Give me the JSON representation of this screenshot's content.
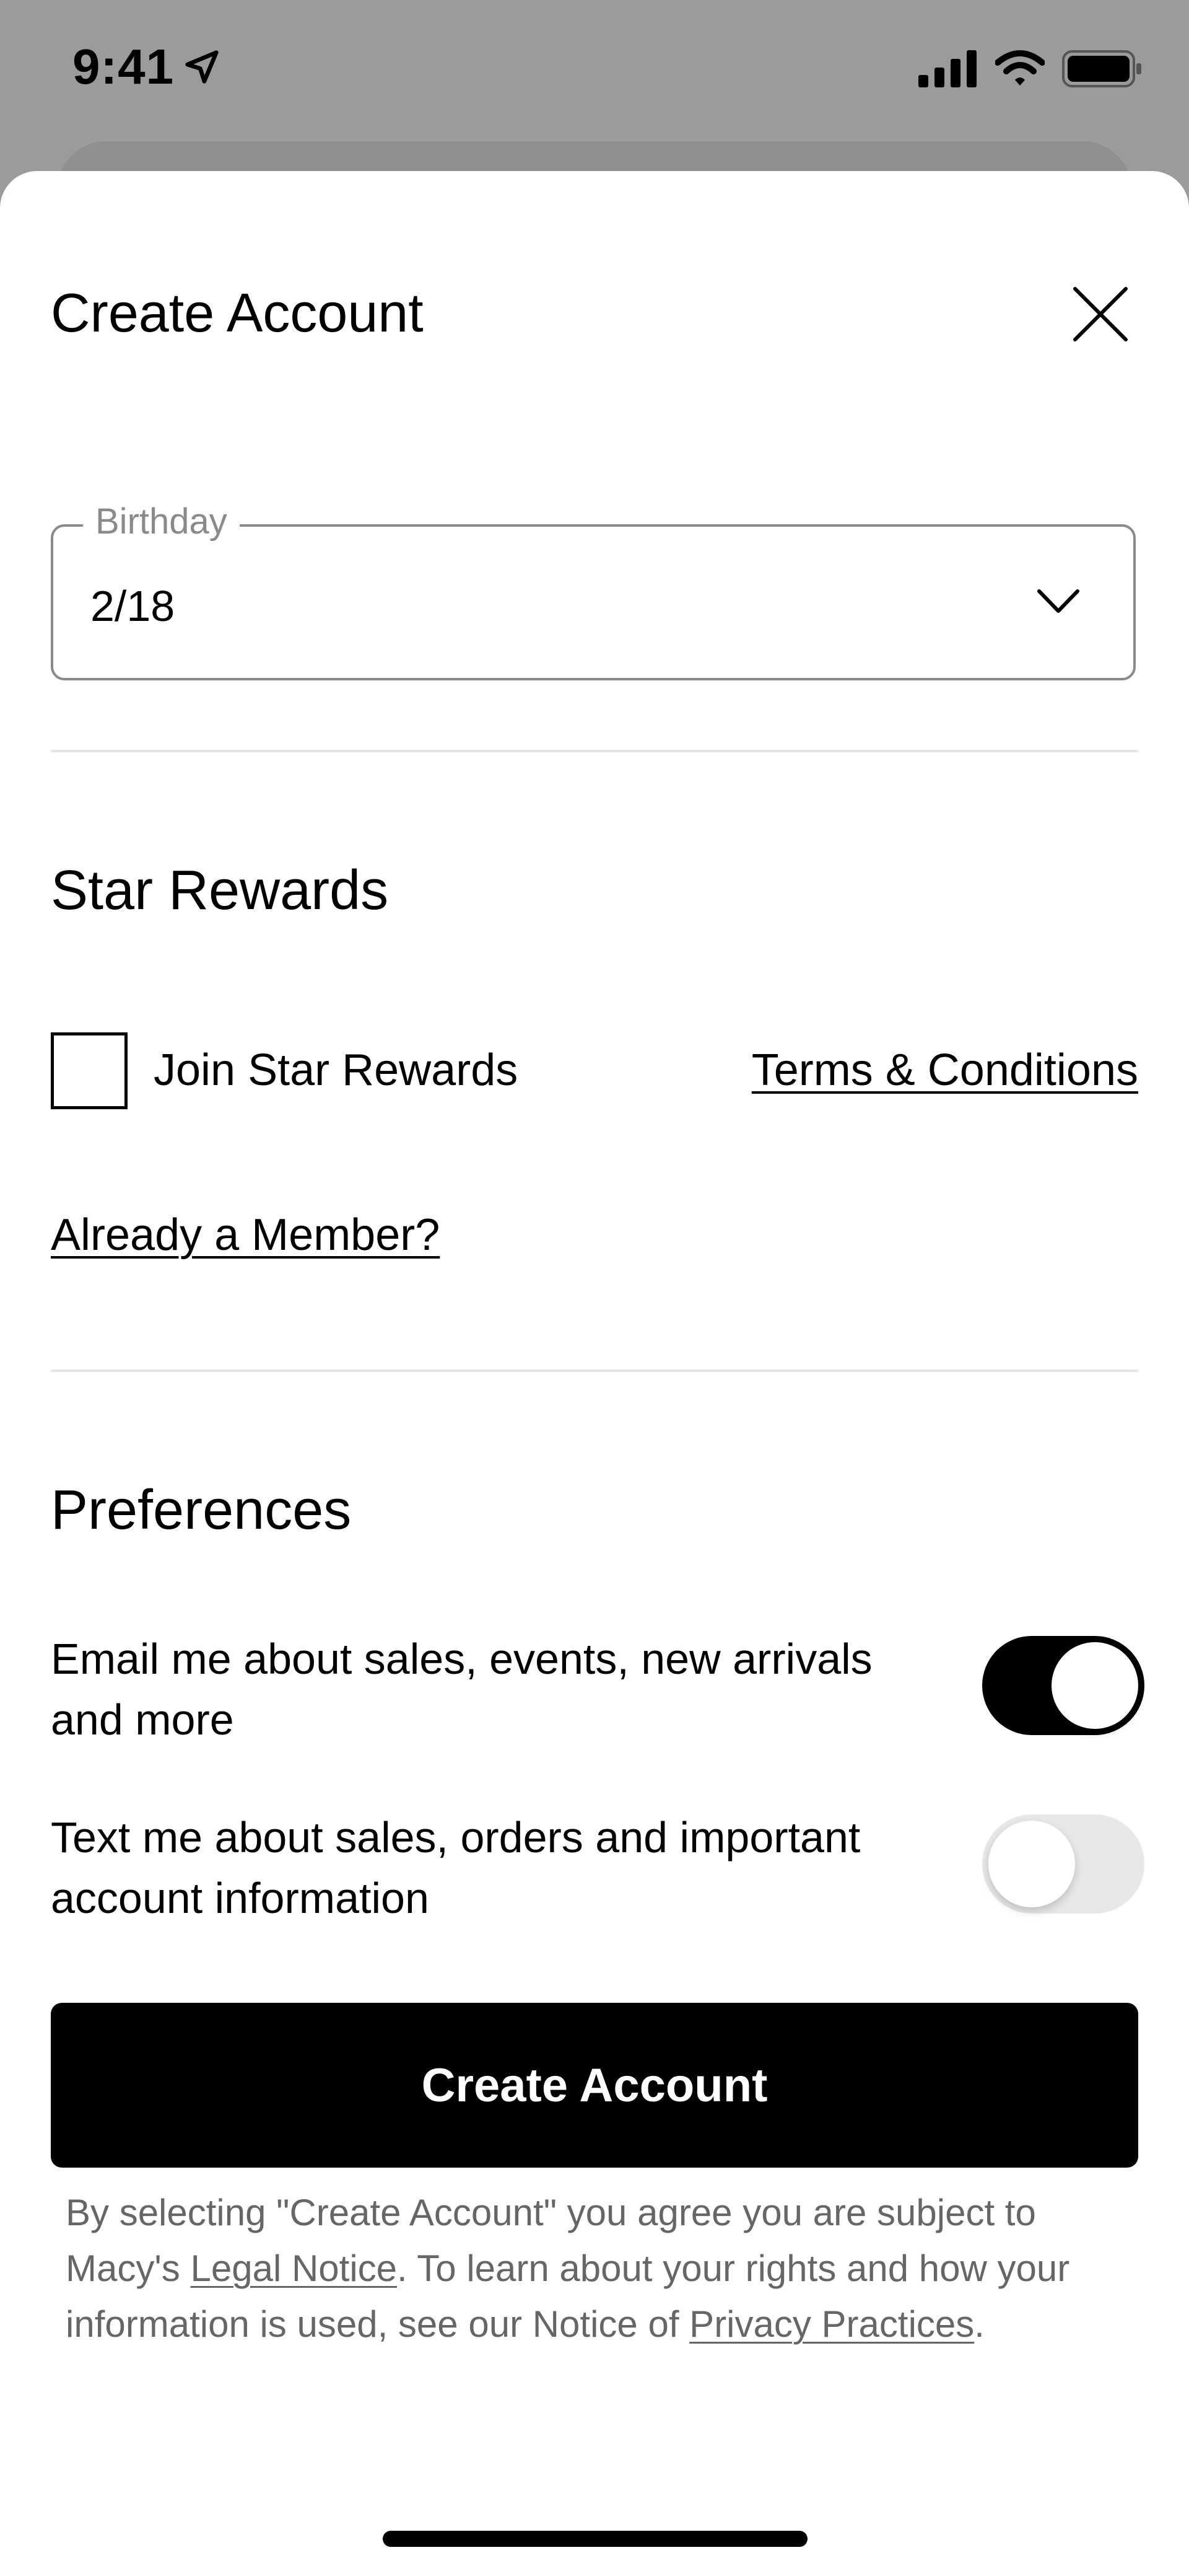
{
  "status_bar": {
    "time": "9:41",
    "icons": [
      "location-arrow-icon",
      "cellular-signal-icon",
      "wifi-icon",
      "battery-icon"
    ]
  },
  "sheet": {
    "title": "Create Account",
    "close_icon": "close-icon"
  },
  "birthday": {
    "label": "Birthday",
    "value": "2/18",
    "icon": "chevron-down-icon"
  },
  "star_rewards": {
    "title": "Star Rewards",
    "join_label": "Join Star Rewards",
    "join_checked": false,
    "terms_link": "Terms & Conditions",
    "member_link": "Already a Member?"
  },
  "preferences": {
    "title": "Preferences",
    "email_text": "Email me about sales, events, new arrivals and more",
    "email_enabled": true,
    "text_text": "Text me about sales, orders and important account information",
    "text_enabled": false
  },
  "cta": {
    "label": "Create Account"
  },
  "legal": {
    "part1": "By selecting \"Create Account\" you agree you are subject to Macy's ",
    "legal_link": "Legal Notice",
    "part2": ". To learn about your rights and how your information is used, see our Notice of ",
    "privacy_link": "Privacy Practices",
    "part3": "."
  },
  "colors": {
    "accent": "#000000",
    "overlay": "#9b9b9b",
    "muted_text": "#666666",
    "toggle_off": "#e8e8e8"
  }
}
